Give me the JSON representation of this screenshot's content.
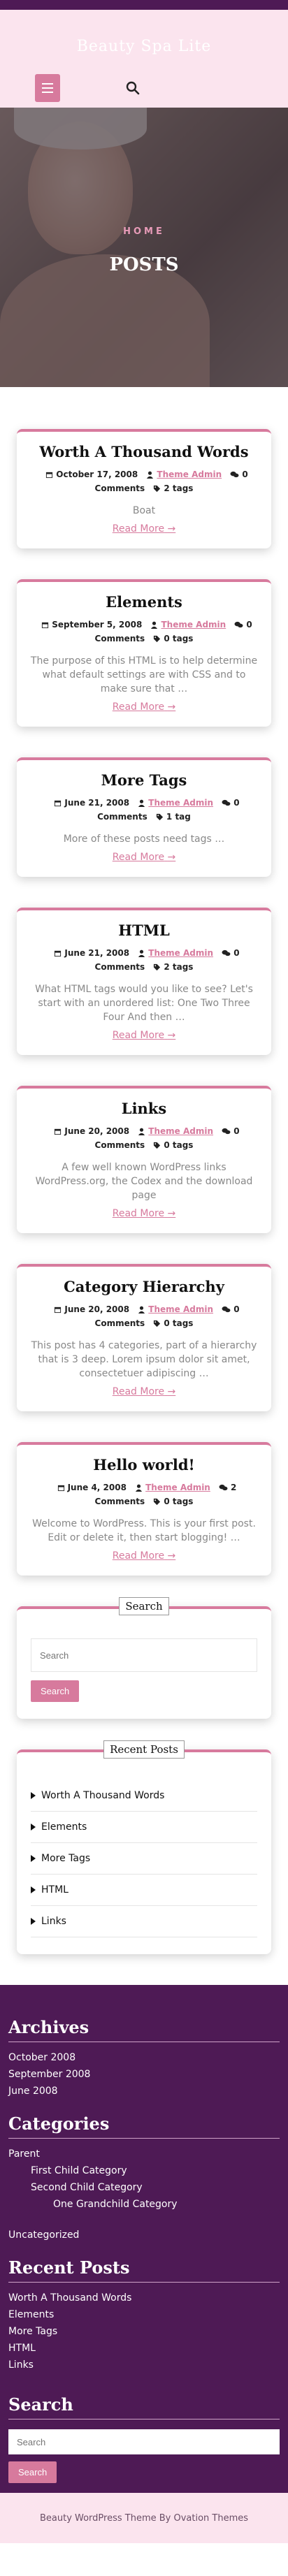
{
  "header": {
    "site_title": "Beauty Spa Lite",
    "menu_icon": "hamburger-icon",
    "search_icon": "search-icon"
  },
  "hero": {
    "breadcrumb": "HOME",
    "title": "POSTS"
  },
  "posts": [
    {
      "title": "Worth A Thousand Words",
      "date": "October 17, 2008",
      "author": "Theme Admin",
      "comments": "0 Comments",
      "tags": "2 tags",
      "excerpt": "Boat",
      "read_more": "Read More"
    },
    {
      "title": "Elements",
      "date": "September 5, 2008",
      "author": "Theme Admin",
      "comments": "0 Comments",
      "tags": "0 tags",
      "excerpt": "The purpose of this HTML is to help determine what default settings are with CSS and to make sure that …",
      "read_more": "Read More"
    },
    {
      "title": "More Tags",
      "date": "June 21, 2008",
      "author": "Theme Admin",
      "comments": "0 Comments",
      "tags": "1 tag",
      "excerpt": "More of these posts need tags …",
      "read_more": "Read More"
    },
    {
      "title": "HTML",
      "date": "June 21, 2008",
      "author": "Theme Admin",
      "comments": "0 Comments",
      "tags": "2 tags",
      "excerpt": "What HTML tags would you like to see? Let's start with an unordered list: One Two Three Four And then …",
      "read_more": "Read More"
    },
    {
      "title": "Links",
      "date": "June 20, 2008",
      "author": "Theme Admin",
      "comments": "0 Comments",
      "tags": "0 tags",
      "excerpt": "A few well known WordPress links WordPress.org, the Codex and the download page",
      "read_more": "Read More"
    },
    {
      "title": "Category Hierarchy",
      "date": "June 20, 2008",
      "author": "Theme Admin",
      "comments": "0 Comments",
      "tags": "0 tags",
      "excerpt": "This post has 4 categories, part of a hierarchy that is 3 deep. Lorem ipsum dolor sit amet, consectetuer adipiscing …",
      "read_more": "Read More"
    },
    {
      "title": "Hello world!",
      "date": "June 4, 2008",
      "author": "Theme Admin",
      "comments": "2 Comments",
      "tags": "0 tags",
      "excerpt": "Welcome to WordPress. This is your first post. Edit or delete it, then start blogging! …",
      "read_more": "Read More"
    }
  ],
  "search_widget": {
    "title": "Search",
    "placeholder": "Search",
    "button": "Search"
  },
  "recent_widget": {
    "title": "Recent Posts",
    "items": [
      "Worth A Thousand Words",
      "Elements",
      "More Tags",
      "HTML",
      "Links"
    ]
  },
  "footer": {
    "archives_title": "Archives",
    "archives": [
      "October 2008",
      "September 2008",
      "June 2008"
    ],
    "categories_title": "Categories",
    "categories": {
      "parent": "Parent",
      "first_child": "First Child Category",
      "second_child": "Second Child Category",
      "grandchild": "One Grandchild Category",
      "uncategorized": "Uncategorized"
    },
    "recent_title": "Recent Posts",
    "recent": [
      "Worth A Thousand Words",
      "Elements",
      "More Tags",
      "HTML",
      "Links"
    ],
    "search_title": "Search",
    "search_placeholder": "Search",
    "search_button": "Search"
  },
  "bottom_bar": {
    "credit": "Beauty WordPress Theme By Ovation Themes"
  },
  "colors": {
    "accent": "#d77a9d",
    "footer_bg": "#4e1a55",
    "header_bg": "#fbe4ee"
  }
}
